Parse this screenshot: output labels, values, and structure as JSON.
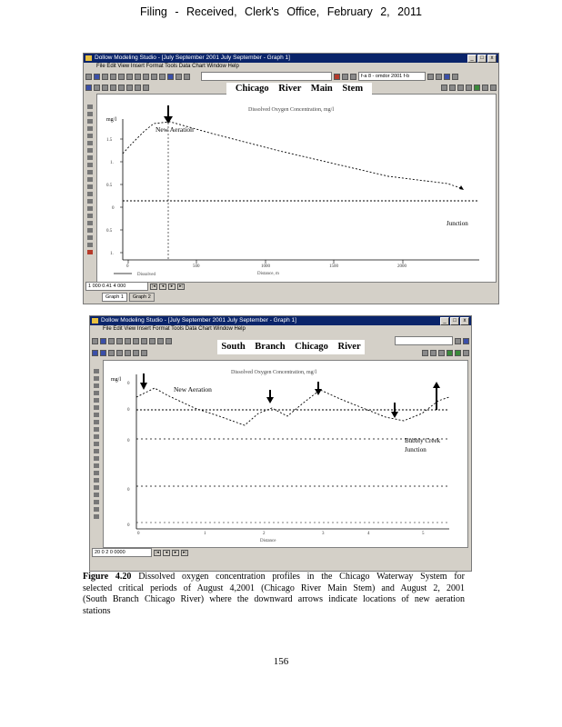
{
  "header": {
    "filing_line": "Filing - Received, Clerk's Office, February 2, 2011"
  },
  "figure1": {
    "window_title": "Dollow Modeling Studio - [July September 2001 July September - Graph 1]",
    "menu": "File Edit View Insert Format Tools Data Chart Window Help",
    "toolbar_combo": "f-a 8 - omdor 2001 f-b",
    "banner": "Chicago River Main Stem",
    "subtitle": "Dissolved Oxygen Concentration, mg/l",
    "y_unit": "mg/l",
    "annotations": {
      "new_aeration": "New Aeration",
      "junction": "Junction"
    },
    "status_value": "1 000 0.41 4 000",
    "tabs": [
      "Graph 1",
      "Graph 2"
    ],
    "x_axis_label": "Distance, m",
    "legend_label": "Dissolved"
  },
  "figure2": {
    "window_title": "Dollow Modeling Studio - [July September 2001 July September - Graph 1]",
    "menu": "File Edit View Insert Format Tools Data Chart Window Help",
    "banner": "South Branch Chicago River",
    "subtitle": "Dissolved Oxygen Concentration, mg/l",
    "y_unit": "mg/l",
    "annotations": {
      "new_aeration": "New Aeration",
      "bubbly_creek": "Bubbly Creek",
      "junction": "Junction"
    },
    "status_value": "20 0 2 0 0000",
    "x_axis_label": "Distance"
  },
  "caption": {
    "label": "Figure 4.20",
    "text": "Dissolved oxygen concentration profiles in the Chicago Waterway System for selected critical periods of August 4,2001 (Chicago River Main Stem) and August 2, 2001 (South Branch Chicago River) where the downward arrows indicate locations of new aeration stations"
  },
  "page_number": "156"
}
